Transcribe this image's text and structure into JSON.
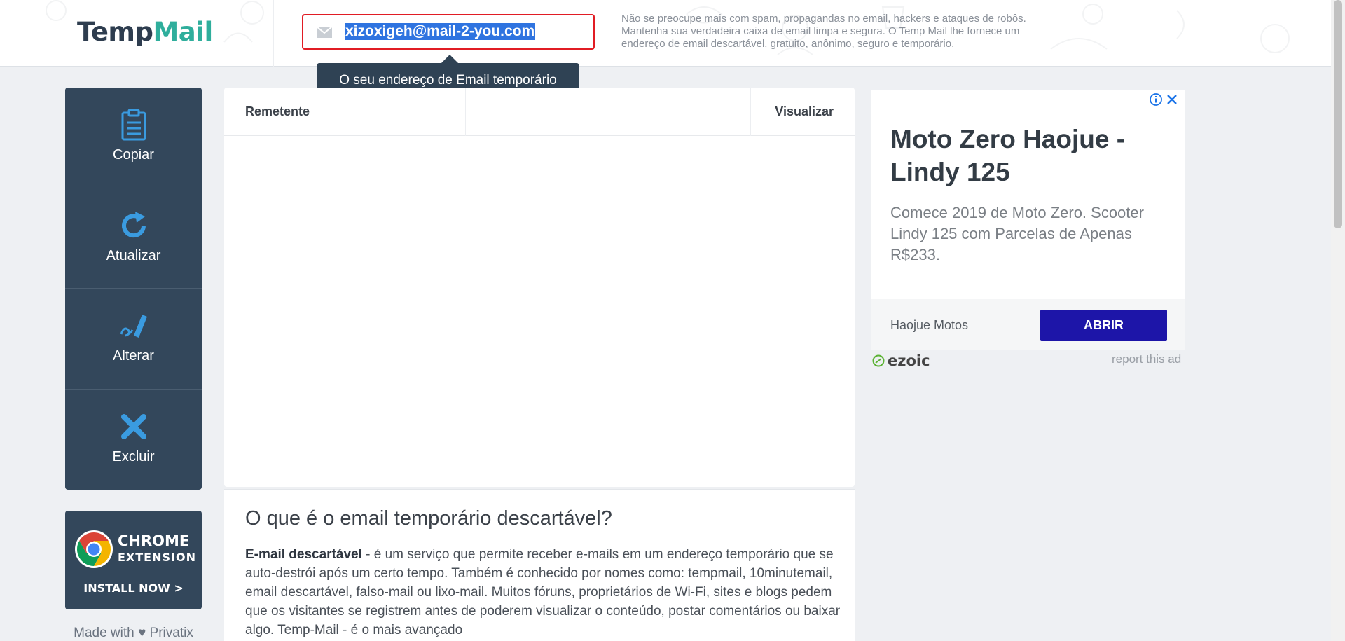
{
  "header": {
    "logo_part1": "Temp",
    "logo_part2": "Mail",
    "email_address": "xizoxigeh@mail-2-you.com",
    "description": "Não se preocupe mais com spam, propagandas no email, hackers e ataques de robôs. Mantenha sua verdadeira caixa de email limpa e segura. O Temp Mail lhe fornece um endereço de email descartável, gratuito, anônimo, seguro e temporário."
  },
  "tooltip": {
    "text": "O seu endereço de Email temporário"
  },
  "sidebar": {
    "items": [
      {
        "label": "Copiar",
        "icon": "clipboard-icon"
      },
      {
        "label": "Atualizar",
        "icon": "refresh-icon"
      },
      {
        "label": "Alterar",
        "icon": "edit-icon"
      },
      {
        "label": "Excluir",
        "icon": "delete-icon"
      }
    ]
  },
  "chrome_extension": {
    "title": "CHROME",
    "subtitle": "EXTENSION",
    "install": "INSTALL NOW >"
  },
  "footer": {
    "made_with": "Made with ♥ Privatix"
  },
  "inbox": {
    "columns": [
      "Remetente",
      "Visualizar"
    ]
  },
  "article": {
    "title": "O que é o email temporário descartável?",
    "lead_bold": "E-mail descartável",
    "body": " - é um serviço que permite receber e-mails em um endereço temporário que se auto-destrói após um certo tempo. Também é conhecido por nomes como: tempmail, 10minutemail, email descartável, falso-mail ou lixo-mail. Muitos fóruns, proprietários de Wi-Fi, sites e blogs pedem que os visitantes se registrem antes de poderem visualizar o conteúdo, postar comentários ou baixar algo. Temp-Mail - é o mais avançado"
  },
  "ad": {
    "title": "Moto Zero Haojue - Lindy 125",
    "description": "Comece 2019 de Moto Zero. Scooter Lindy 125 com Parcelas de Apenas R$233.",
    "brand": "Haojue Motos",
    "cta": "ABRIR",
    "network": "ezoic",
    "report": "report this ad"
  },
  "colors": {
    "sidebar_bg": "#33475b",
    "icon_blue": "#3a9be0",
    "highlight_border": "#e11c24",
    "selection": "#2f74e0",
    "ad_button": "#1d15a8",
    "logo_green": "#2fae9c"
  }
}
